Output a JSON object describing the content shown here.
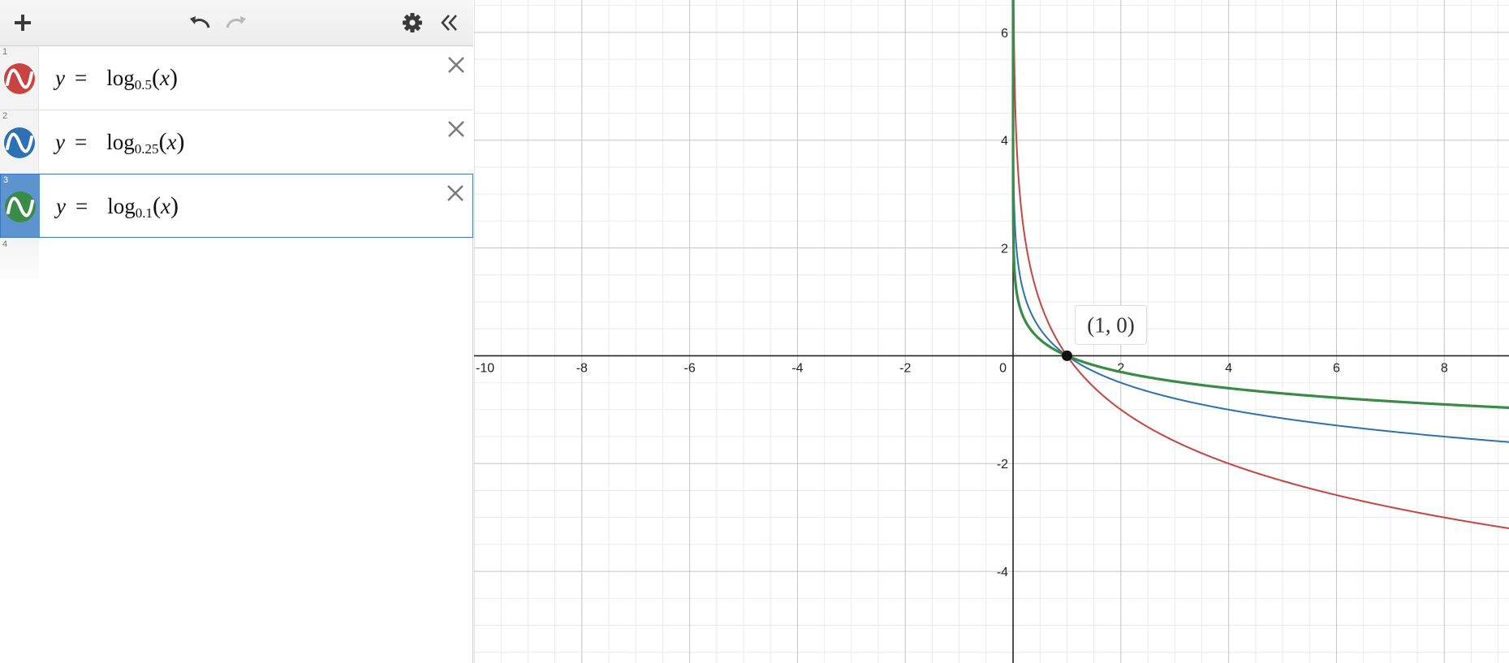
{
  "toolbar": {
    "add_icon": "plus-icon",
    "undo_icon": "undo-icon",
    "redo_icon": "redo-icon",
    "settings_icon": "gear-icon",
    "collapse_icon": "double-chevron-left-icon"
  },
  "expressions": [
    {
      "index": "1",
      "lhs": "y",
      "eq": "=",
      "func": "log",
      "base": "0.5",
      "arg": "x",
      "color": "#c74440"
    },
    {
      "index": "2",
      "lhs": "y",
      "eq": "=",
      "func": "log",
      "base": "0.25",
      "arg": "x",
      "color": "#2d70b3"
    },
    {
      "index": "3",
      "lhs": "y",
      "eq": "=",
      "func": "log",
      "base": "0.1",
      "arg": "x",
      "color": "#388c46"
    }
  ],
  "empty_row_index": "4",
  "colors": {
    "red": "#c74440",
    "blue": "#2d70b3",
    "green": "#388c46",
    "selected_tab": "#5d93cf",
    "selected_border": "#3b78c3"
  },
  "chart_data": {
    "type": "line",
    "xlim": [
      -10,
      9.2
    ],
    "ylim": [
      -5.7,
      6.6
    ],
    "grid": true,
    "x_tick_labels": [
      "-10",
      "-8",
      "-6",
      "-4",
      "-2",
      "0",
      "2",
      "4",
      "6",
      "8"
    ],
    "y_tick_labels": [
      "6",
      "4",
      "2",
      "-2",
      "-4"
    ],
    "series": [
      {
        "base": 0.5,
        "color": "#c74440",
        "width": 2
      },
      {
        "base": 0.25,
        "color": "#2d70b3",
        "width": 2
      },
      {
        "base": 0.1,
        "color": "#388c46",
        "width": 3.2
      }
    ],
    "point": {
      "x": 1,
      "y": 0,
      "label": "(1, 0)"
    }
  }
}
